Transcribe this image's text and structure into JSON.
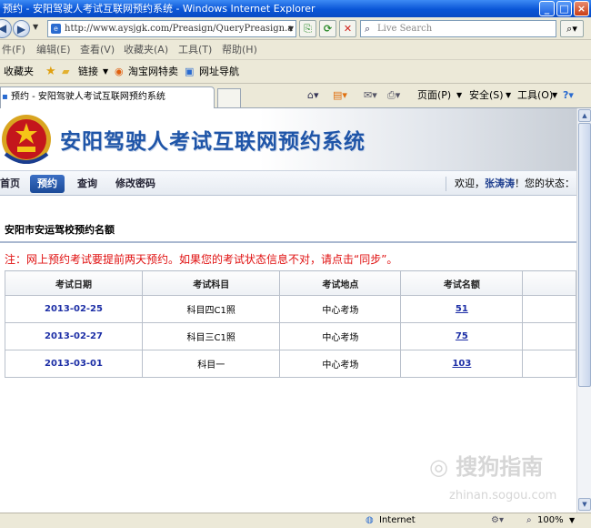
{
  "window": {
    "title": "预约 - 安阳驾驶人考试互联网预约系统 - Windows Internet Explorer",
    "min_icon": "minimize-icon",
    "max_icon": "maximize-icon",
    "close_icon": "close-icon"
  },
  "address_bar": {
    "url": "http://www.aysjgk.com/Preasign/QueryPreasign.a",
    "search_placeholder": "Live Search"
  },
  "menu": [
    "件(F)",
    "编辑(E)",
    "查看(V)",
    "收藏夹(A)",
    "工具(T)",
    "帮助(H)"
  ],
  "favorites": {
    "label": "收藏夹",
    "links": "链接",
    "taobao": "淘宝网特卖",
    "nav": "网址导航"
  },
  "tab": {
    "title": "预约 - 安阳驾驶人考试互联网预约系统"
  },
  "command_bar": {
    "page": "页面(P)",
    "safety": "安全(S)",
    "tools": "工具(O)"
  },
  "site": {
    "title": "安阳驾驶人考试互联网预约系统",
    "nav": [
      "首页",
      "预约",
      "查询",
      "修改密码"
    ],
    "welcome_prefix": "欢迎，",
    "user": "张涛涛",
    "welcome_suffix": "！您的状态："
  },
  "section_title": "安阳市安运驾校预约名额",
  "notice": "注：网上预约考试要提前两天预约。如果您的考试状态信息不对，请点击“同步”。",
  "table": {
    "headers": [
      "考试日期",
      "考试科目",
      "考试地点",
      "考试名额"
    ],
    "rows": [
      {
        "date": "2013-02-25",
        "subject": "科目四C1照",
        "location": "中心考场",
        "quota": "51"
      },
      {
        "date": "2013-02-27",
        "subject": "科目三C1照",
        "location": "中心考场",
        "quota": "75"
      },
      {
        "date": "2013-03-01",
        "subject": "科目一",
        "location": "中心考场",
        "quota": "103"
      }
    ]
  },
  "status_bar": {
    "zone": "Internet",
    "zoom": "100%"
  },
  "watermark": {
    "text": "搜狗指南",
    "url": "zhinan.sogou.com"
  },
  "colors": {
    "title_blue": "#1f55a8",
    "notice_red": "#e01010",
    "link_blue": "#1d2fa6"
  }
}
